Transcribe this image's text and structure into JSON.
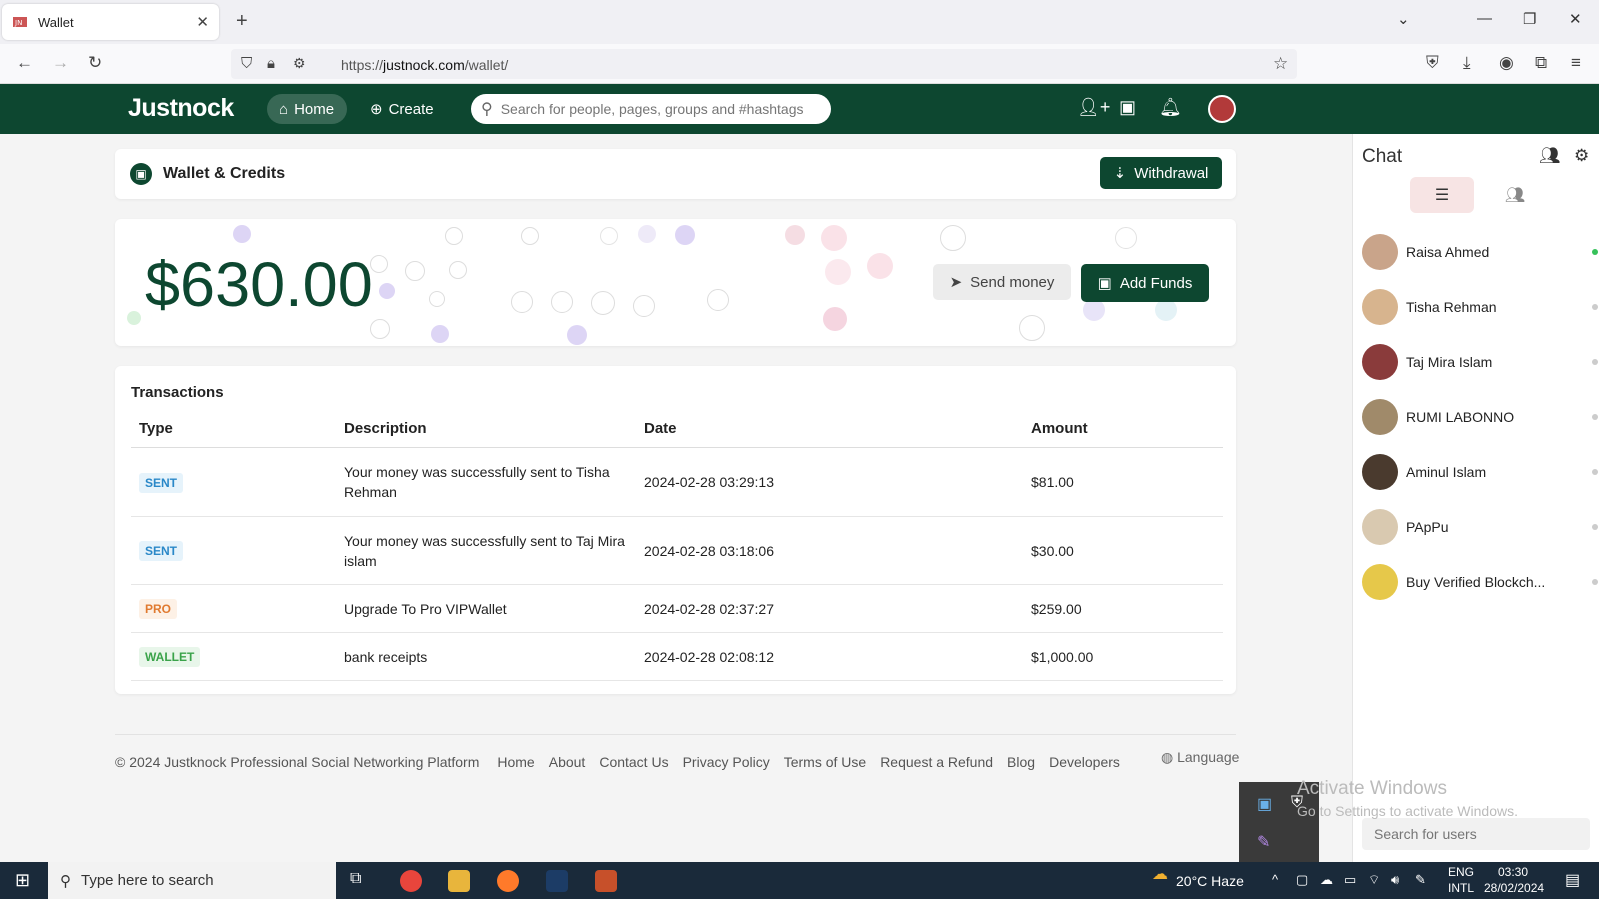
{
  "browser": {
    "tab_title": "Wallet",
    "url_prefix": "https://",
    "url_host": "justnock.com",
    "url_path": "/wallet/"
  },
  "header": {
    "logo": "Justnock",
    "home_label": "Home",
    "create_label": "Create",
    "search_placeholder": "Search for people, pages, groups and #hashtags"
  },
  "wallet": {
    "title": "Wallet & Credits",
    "withdraw_label": "Withdrawal",
    "balance": "$630.00",
    "send_label": "Send money",
    "add_label": "Add Funds"
  },
  "transactions": {
    "title": "Transactions",
    "columns": [
      "Type",
      "Description",
      "Date",
      "Amount"
    ],
    "rows": [
      {
        "type": "SENT",
        "description": "Your money was successfully sent to Tisha Rehman",
        "date": "2024-02-28 03:29:13",
        "amount": "$81.00"
      },
      {
        "type": "SENT",
        "description": "Your money was successfully sent to Taj Mira islam",
        "date": "2024-02-28 03:18:06",
        "amount": "$30.00"
      },
      {
        "type": "PRO",
        "description": "Upgrade To Pro VIPWallet",
        "date": "2024-02-28 02:37:27",
        "amount": "$259.00"
      },
      {
        "type": "WALLET",
        "description": "bank receipts",
        "date": "2024-02-28 02:08:12",
        "amount": "$1,000.00"
      }
    ]
  },
  "footer": {
    "copyright": "© 2024 Justknock Professional Social Networking Platform",
    "links": [
      "Home",
      "About",
      "Contact Us",
      "Privacy Policy",
      "Terms of Use",
      "Request a Refund",
      "Blog",
      "Developers"
    ],
    "language": "Language"
  },
  "chat": {
    "title": "Chat",
    "contacts": [
      {
        "name": "Raisa Ahmed",
        "online": true
      },
      {
        "name": "Tisha Rehman",
        "online": false
      },
      {
        "name": "Taj Mira Islam",
        "online": false
      },
      {
        "name": "RUMI LABONNO",
        "online": false
      },
      {
        "name": "Aminul Islam",
        "online": false
      },
      {
        "name": "PApPu",
        "online": false
      },
      {
        "name": "Buy Verified Blockch...",
        "online": false
      }
    ],
    "search_placeholder": "Search for users"
  },
  "watermark": {
    "line1": "Activate Windows",
    "line2": "Go to Settings to activate Windows."
  },
  "taskbar": {
    "search_placeholder": "Type here to search",
    "weather": "20°C  Haze",
    "lang1": "ENG",
    "lang2": "INTL",
    "time": "03:30",
    "date": "28/02/2024"
  },
  "colors": {
    "brand": "#0d4730"
  }
}
